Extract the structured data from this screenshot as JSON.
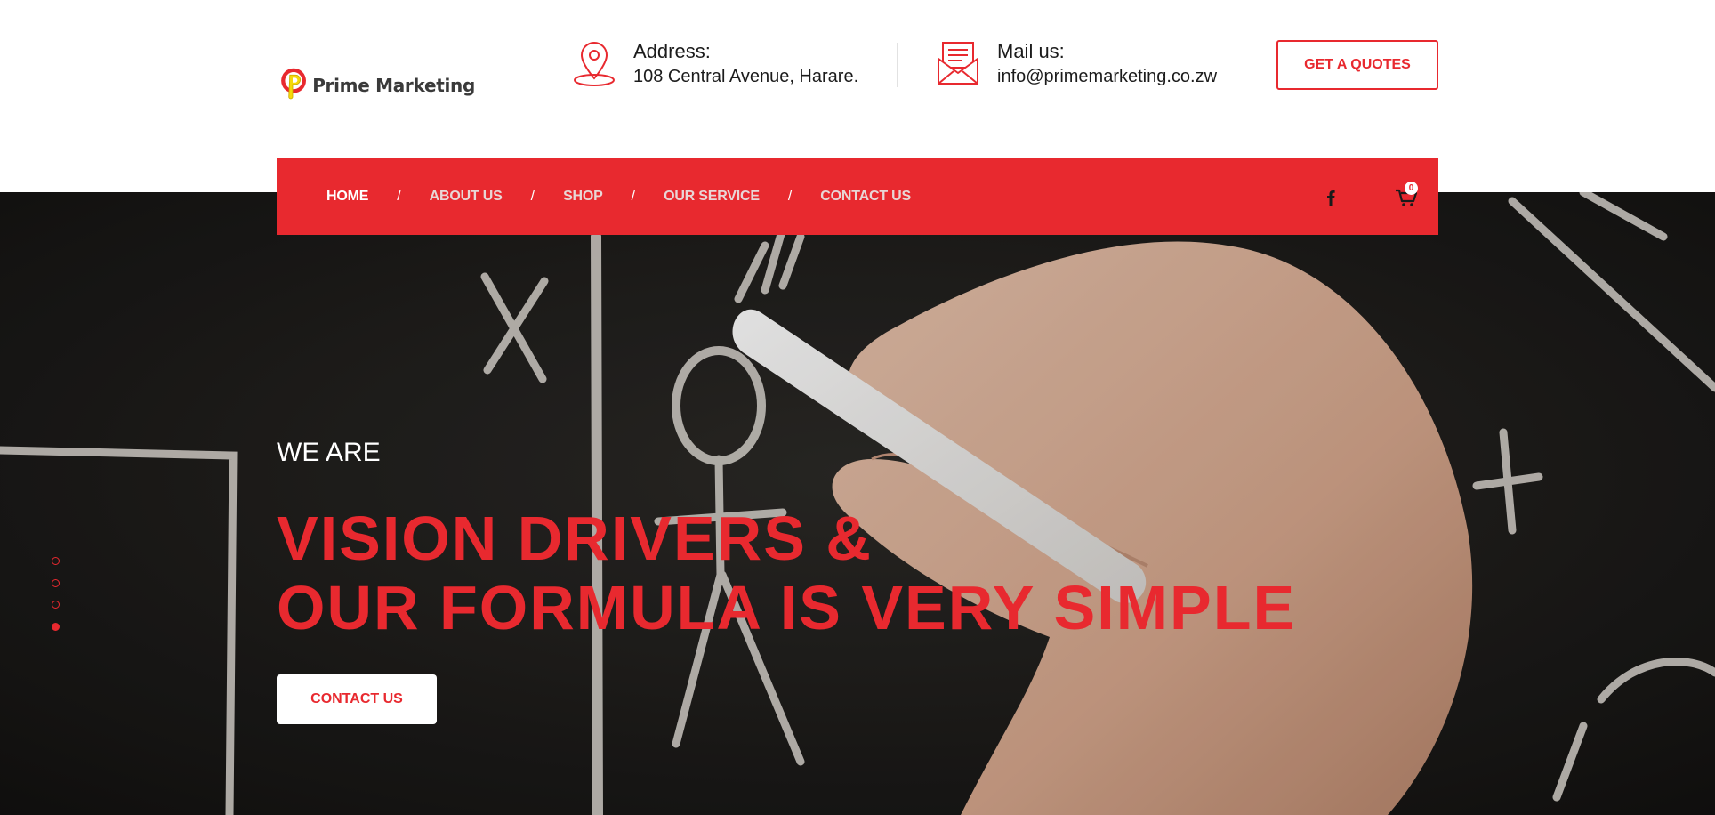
{
  "brand": {
    "name": "Prime Marketing",
    "logo_letter": "P"
  },
  "header": {
    "address_label": "Address:",
    "address_value": "108 Central Avenue, Harare.",
    "mail_label": "Mail us:",
    "mail_value": "info@primemarketing.co.zw",
    "quote_button": "GET A QUOTES"
  },
  "nav": {
    "items": [
      {
        "label": "HOME",
        "active": true
      },
      {
        "label": "ABOUT US",
        "active": false
      },
      {
        "label": "SHOP",
        "active": false
      },
      {
        "label": "OUR SERVICE",
        "active": false
      },
      {
        "label": "CONTACT US",
        "active": false
      }
    ],
    "separator": "/",
    "social_icon": "facebook-icon",
    "cart_icon": "cart-icon",
    "cart_count": "0"
  },
  "hero": {
    "eyebrow": "WE ARE",
    "title_line1": "VISION DRIVERS &",
    "title_line2": "OUR FORMULA IS VERY SIMPLE",
    "cta_label": "CONTACT US",
    "slide_count": 4,
    "active_slide": 4
  },
  "colors": {
    "accent": "#e8292f",
    "chalkboard": "#1e1c1a",
    "text": "#1c1c1c"
  }
}
